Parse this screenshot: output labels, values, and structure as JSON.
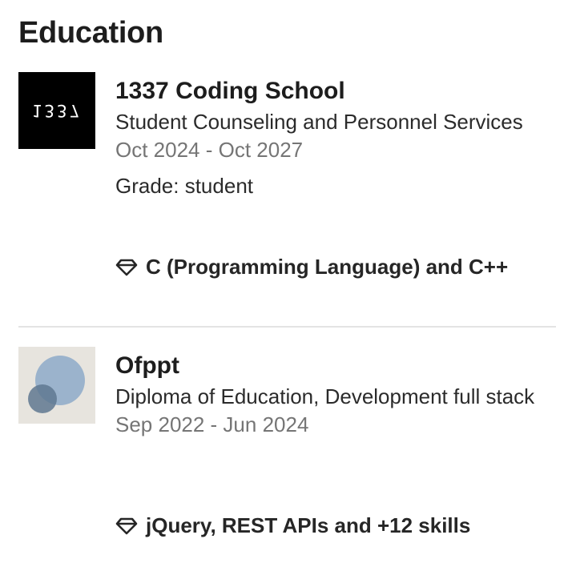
{
  "section": {
    "title": "Education"
  },
  "entries": [
    {
      "logo_text": "1337",
      "school": "1337 Coding School",
      "degree": "Student Counseling and Personnel Services",
      "dates": "Oct 2024 - Oct 2027",
      "grade": "Grade: student",
      "skills": "C (Programming Language) and C++",
      "skills_icon": "diamond-icon"
    },
    {
      "school": "Ofppt",
      "degree": "Diploma of Education, Development full stack",
      "dates": "Sep 2022 - Jun 2024",
      "skills": "jQuery, REST APIs and +12 skills",
      "skills_icon": "diamond-icon"
    }
  ],
  "colors": {
    "logo_1337_bg": "#000000",
    "logo_ofppt_bg": "#e7e4de",
    "logo_ofppt_circle_light": "#9bb3cc",
    "logo_ofppt_circle_dark": "#5f7891",
    "muted_text": "#757575",
    "divider": "#e3e3e3"
  }
}
